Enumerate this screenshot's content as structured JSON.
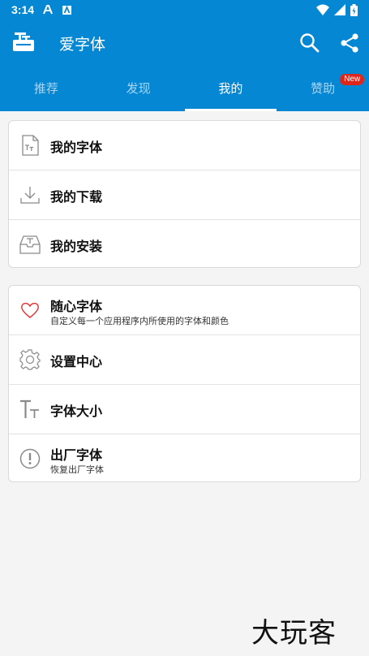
{
  "status_bar": {
    "time": "3:14",
    "left_icons": [
      "a-icon",
      "app-icon"
    ],
    "right_icons": [
      "wifi-icon",
      "signal-icon",
      "battery-icon"
    ]
  },
  "app_bar": {
    "title": "爱字体",
    "logo": "font-app-logo",
    "actions": [
      "search-icon",
      "share-icon"
    ]
  },
  "tabs": [
    {
      "label": "推荐",
      "active": false
    },
    {
      "label": "发现",
      "active": false
    },
    {
      "label": "我的",
      "active": true
    },
    {
      "label": "赞助",
      "active": false,
      "badge": "New"
    }
  ],
  "card1": [
    {
      "label": "我的字体",
      "icon": "font-file-icon"
    },
    {
      "label": "我的下载",
      "icon": "download-icon"
    },
    {
      "label": "我的安装",
      "icon": "install-tray-icon"
    }
  ],
  "card2": [
    {
      "label": "随心字体",
      "sub": "自定义每一个应用程序内所使用的字体和颜色",
      "icon": "heart-icon"
    },
    {
      "label": "设置中心",
      "icon": "gear-icon"
    },
    {
      "label": "字体大小",
      "icon": "text-size-icon"
    },
    {
      "label": "出厂字体",
      "sub": "恢复出厂字体",
      "icon": "exclamation-icon"
    }
  ],
  "watermark": "大玩客",
  "colors": {
    "primary": "#0587d3",
    "badge": "#e0261b",
    "heart": "#e53935"
  }
}
